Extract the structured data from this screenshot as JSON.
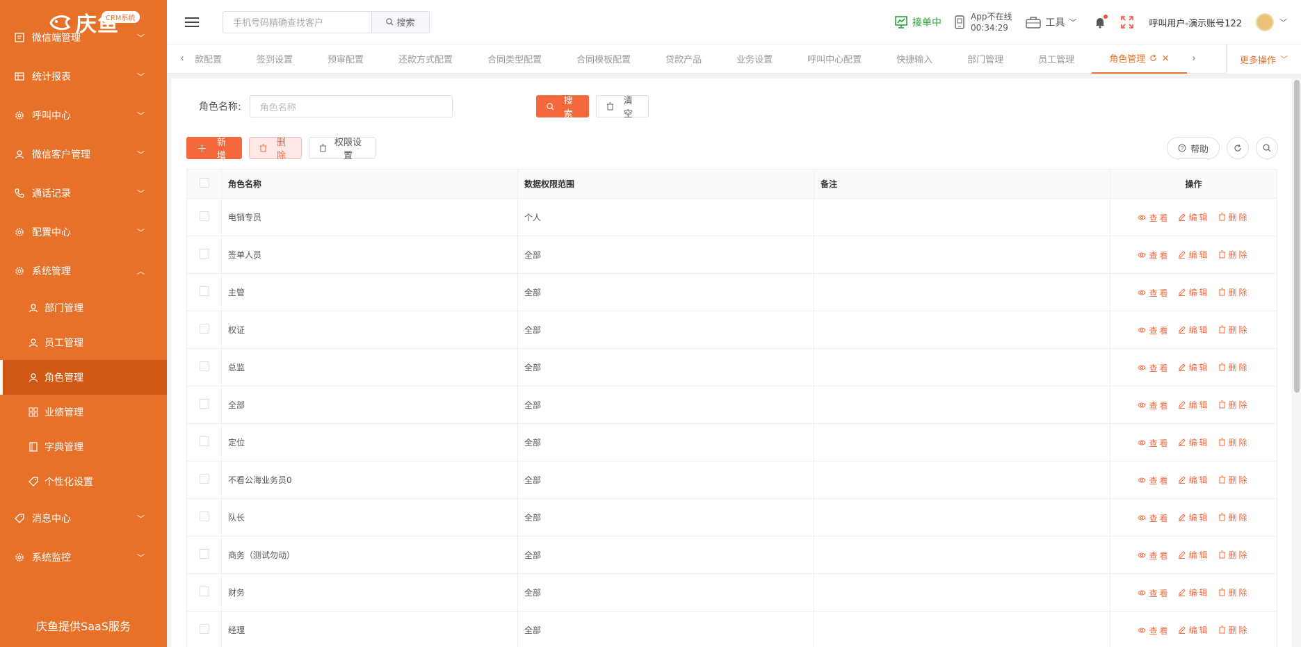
{
  "brand": {
    "name": "庆鱼",
    "badge": "CRM系统"
  },
  "sidebar": {
    "partial_item": {
      "label": "微信端管理"
    },
    "items": [
      {
        "label": "统计报表",
        "icon": "table-icon",
        "expanded": false
      },
      {
        "label": "呼叫中心",
        "icon": "gear-icon",
        "expanded": false
      },
      {
        "label": "微信客户管理",
        "icon": "user-icon",
        "expanded": false
      },
      {
        "label": "通话记录",
        "icon": "phone-icon",
        "expanded": false
      },
      {
        "label": "配置中心",
        "icon": "gear-icon",
        "expanded": false
      },
      {
        "label": "系统管理",
        "icon": "gear-icon",
        "expanded": true
      }
    ],
    "sub_items": [
      {
        "label": "部门管理",
        "icon": "user-icon",
        "active": false
      },
      {
        "label": "员工管理",
        "icon": "user-icon",
        "active": false
      },
      {
        "label": "角色管理",
        "icon": "user-icon",
        "active": true
      },
      {
        "label": "业绩管理",
        "icon": "grid-icon",
        "active": false
      },
      {
        "label": "字典管理",
        "icon": "book-icon",
        "active": false
      },
      {
        "label": "个性化设置",
        "icon": "tag-icon",
        "active": false
      }
    ],
    "bottom_items": [
      {
        "label": "消息中心",
        "icon": "tag-icon"
      },
      {
        "label": "系统监控",
        "icon": "gear-icon"
      }
    ],
    "footer": "庆鱼提供SaaS服务",
    "colors": {
      "bg": "#e8712a",
      "active": "#d05a14"
    }
  },
  "header": {
    "search_placeholder": "手机号码精确查找客户",
    "search_button": "搜索",
    "status": "接单中",
    "app_status": "App不在线",
    "app_timer": "00:34:29",
    "tools": "工具",
    "user": "呼叫用户-演示账号122"
  },
  "tabs": {
    "items": [
      "款配置",
      "签到设置",
      "预审配置",
      "还款方式配置",
      "合同类型配置",
      "合同模板配置",
      "贷款产品",
      "业务设置",
      "呼叫中心配置",
      "快捷输入",
      "部门管理",
      "员工管理"
    ],
    "active": "角色管理",
    "more": "更多操作"
  },
  "filter": {
    "label": "角色名称:",
    "placeholder": "角色名称",
    "search": "搜 索",
    "clear": "清 空"
  },
  "toolbar": {
    "add": "新 增",
    "delete": "删 除",
    "permissions": "权限设置",
    "help": "帮助"
  },
  "table": {
    "headers": [
      "角色名称",
      "数据权限范围",
      "备注",
      "操作"
    ],
    "rows": [
      {
        "name": "电销专员",
        "scope": "个人",
        "note": ""
      },
      {
        "name": "签单人员",
        "scope": "全部",
        "note": ""
      },
      {
        "name": "主管",
        "scope": "全部",
        "note": ""
      },
      {
        "name": "权证",
        "scope": "全部",
        "note": ""
      },
      {
        "name": "总监",
        "scope": "全部",
        "note": ""
      },
      {
        "name": "全部",
        "scope": "全部",
        "note": ""
      },
      {
        "name": "定位",
        "scope": "全部",
        "note": ""
      },
      {
        "name": "不看公海业务员0",
        "scope": "全部",
        "note": ""
      },
      {
        "name": "队长",
        "scope": "全部",
        "note": ""
      },
      {
        "name": "商务（测试勿动）",
        "scope": "全部",
        "note": ""
      },
      {
        "name": "财务",
        "scope": "全部",
        "note": ""
      },
      {
        "name": "经理",
        "scope": "全部",
        "note": ""
      }
    ],
    "ops": {
      "view": "查看",
      "edit": "编辑",
      "delete": "删除"
    }
  },
  "accent": "#f5683c"
}
